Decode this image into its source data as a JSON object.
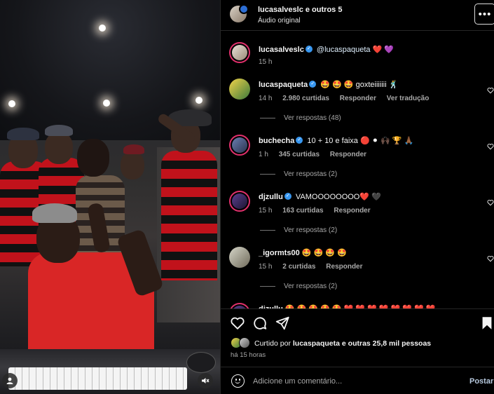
{
  "header": {
    "title": "lucasalveslc e outros 5",
    "subtitle": "Áudio original",
    "more_label": "•••"
  },
  "caption": {
    "username": "lucasalveslc",
    "mention": "@lucaspaqueta",
    "emojis": "❤️ 💜",
    "time": "15 h"
  },
  "comments": [
    {
      "username": "lucaspaqueta",
      "verified": true,
      "text": "🤩 🤩 🤩  goxteiiiiiii 🕺",
      "time": "14 h",
      "likes": "2.980 curtidas",
      "reply": "Responder",
      "translate": "Ver tradução",
      "view_replies": "Ver respostas (48)"
    },
    {
      "username": "buchecha",
      "verified": true,
      "text": "10 + 10 e faixa 🔴 ⚫ 🙌🏿 🏆 🙏🏾",
      "time": "1 h",
      "likes": "345 curtidas",
      "reply": "Responder",
      "view_replies": "Ver respostas (2)"
    },
    {
      "username": "djzullu",
      "verified": true,
      "text": "VAMOOOOOOOO❤️ 🖤",
      "time": "15 h",
      "likes": "163 curtidas",
      "reply": "Responder",
      "view_replies": "Ver respostas (2)"
    },
    {
      "username": "_igormts00",
      "verified": false,
      "text": "🤩 🤩 🤩 🤩",
      "time": "15 h",
      "likes": "2 curtidas",
      "reply": "Responder",
      "view_replies": "Ver respostas (2)"
    },
    {
      "username": "djzullu",
      "verified": false,
      "text": "🤩 🤩 🤩 🤩 🤩 ❤️ ❤️ ❤️ ❤️ ❤️ ❤️ ❤️ ❤️",
      "partial": true
    }
  ],
  "likes_line": {
    "prefix": "Curtido por",
    "user": "lucaspaqueta",
    "connector": "e",
    "others": "outras 25,8 mil pessoas"
  },
  "post_time": "há 15 horas",
  "add_comment": {
    "placeholder": "Adicione um comentário...",
    "post_label": "Postar"
  },
  "colors": {
    "background": "#000000",
    "text_primary": "#f5f5f5",
    "text_secondary": "#a8a8a8",
    "verified_blue": "#3897f0",
    "story_ring": "#e1306c"
  }
}
